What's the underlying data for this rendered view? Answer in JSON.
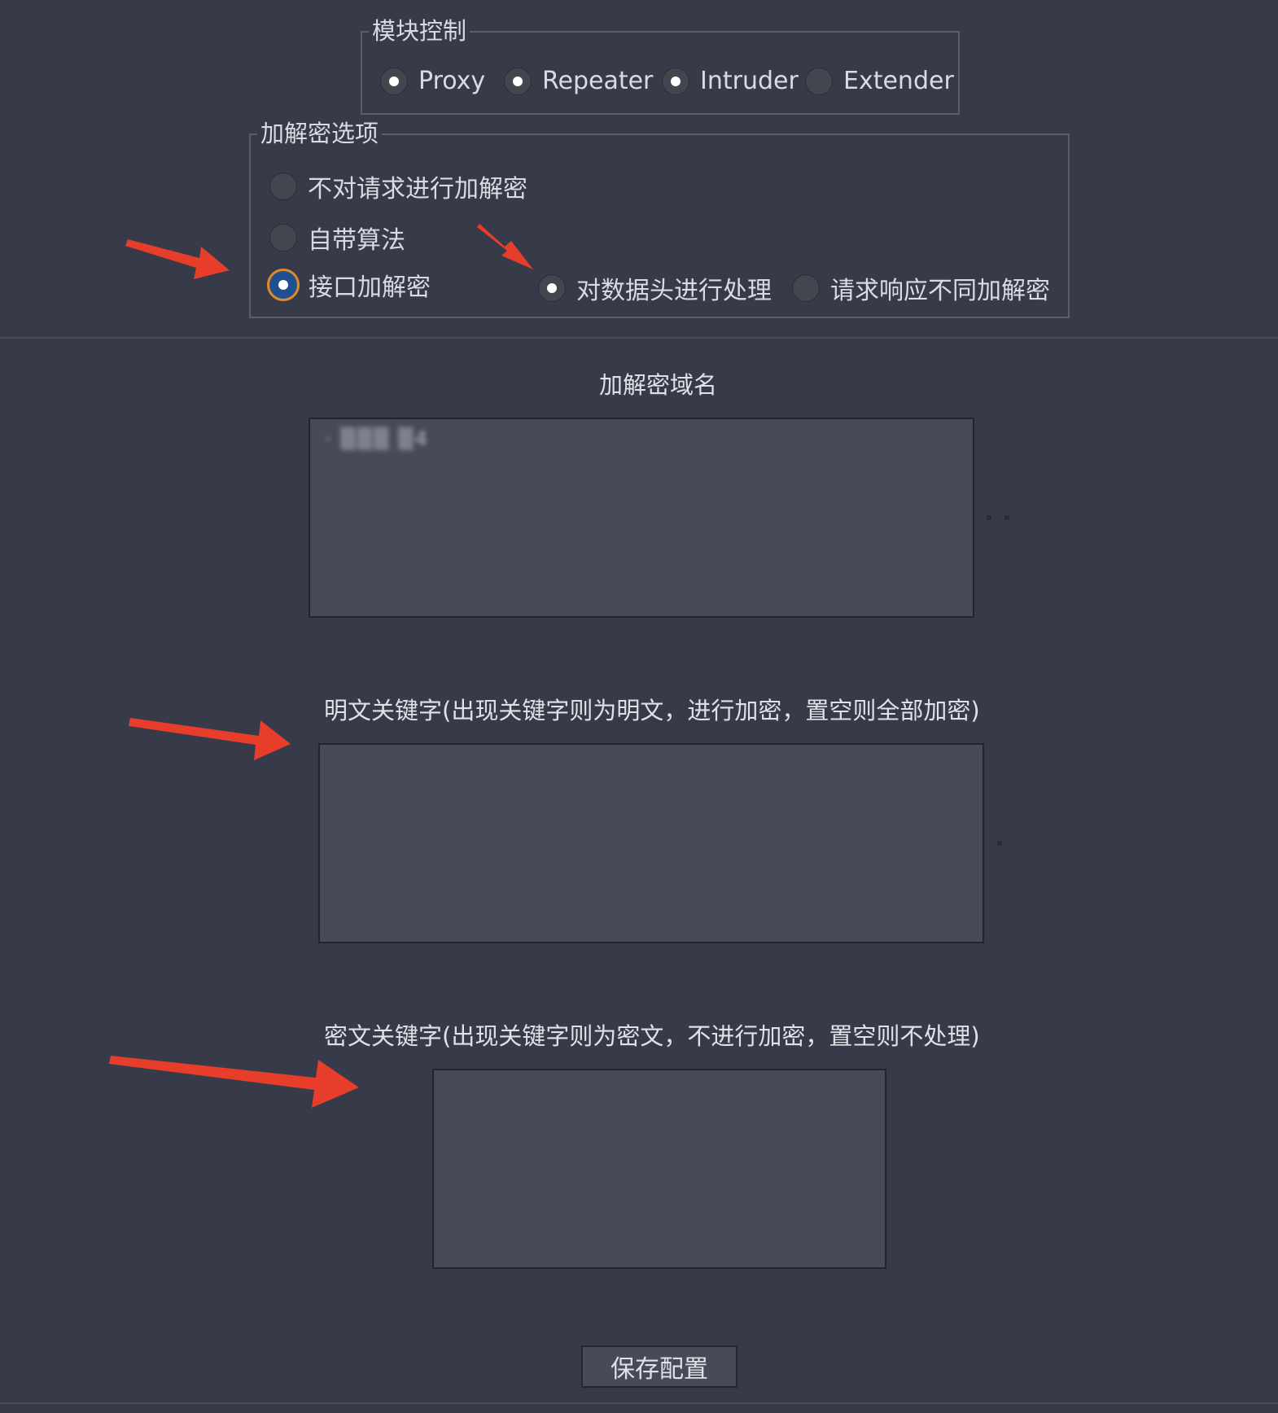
{
  "module_control": {
    "title": "模块控制",
    "options": [
      {
        "label": "Proxy",
        "checked": true
      },
      {
        "label": "Repeater",
        "checked": true
      },
      {
        "label": "Intruder",
        "checked": true
      },
      {
        "label": "Extender",
        "checked": false
      }
    ]
  },
  "crypto_options": {
    "title": "加解密选项",
    "no_crypto": "不对请求进行加解密",
    "builtin": "自带算法",
    "api_crypto": "接口加解密",
    "process_headers": "对数据头进行处理",
    "diff_req_resp": "请求响应不同加解密",
    "selected": "api_crypto"
  },
  "domain": {
    "label": "加解密域名",
    "value": "· ▒▒▒ ▒4"
  },
  "plain_keywords": {
    "label": "明文关键字(出现关键字则为明文，进行加密，置空则全部加密)",
    "value": ""
  },
  "cipher_keywords": {
    "label": "密文关键字(出现关键字则为密文，不进行加密，置空则不处理)",
    "value": ""
  },
  "save_button": {
    "label": "保存配置"
  },
  "colors": {
    "background": "#373a48",
    "textarea": "#474b59",
    "annotation_arrow": "#e63e2a",
    "focus_ring": "#e08a2c",
    "radio_selected_fill": "#1f4f8e"
  },
  "annotation_icons": [
    "red-arrow-icon",
    "red-arrow-icon",
    "red-arrow-icon",
    "red-arrow-icon"
  ]
}
